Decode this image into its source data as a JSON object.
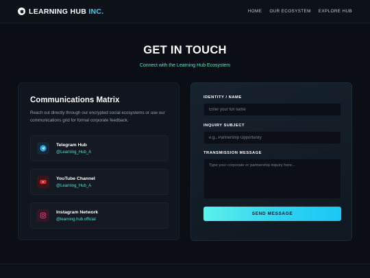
{
  "nav": {
    "brand_main": "LEARNING HUB ",
    "brand_accent": "INC.",
    "links": [
      "HOME",
      "OUR ECOSYSTEM",
      "EXPLORE HUB"
    ]
  },
  "hero": {
    "title": "GET IN TOUCH",
    "subtitle": "Connect with the Learning Hub Ecosystem"
  },
  "matrix": {
    "title": "Communications Matrix",
    "description": "Reach out directly through our encrypted social ecosystems or use our communications grid for formal corporate feedback.",
    "channels": [
      {
        "name": "Telegram Hub",
        "handle": "@Learning_Hub_A",
        "icon": "telegram-icon",
        "color": "#2aa3e0"
      },
      {
        "name": "YouTube Channel",
        "handle": "@Learning_Hub_A",
        "icon": "youtube-icon",
        "color": "#e02a2a"
      },
      {
        "name": "Instagram Network",
        "handle": "@learning.hub.official",
        "icon": "instagram-icon",
        "color": "#e23b76"
      }
    ]
  },
  "form": {
    "identity_label": "IDENTITY / NAME",
    "identity_placeholder": "Enter your full name",
    "inquiry_label": "INQUIRY SUBJECT",
    "inquiry_placeholder": "e.g., Partnership Opportunity",
    "message_label": "TRANSMISSION MESSAGE",
    "message_placeholder": "Type your corporate or partnership inquiry here...",
    "submit_label": "SEND MESSAGE"
  },
  "colors": {
    "accent": "#34d3ee",
    "teal_text": "#4ee6d3",
    "background": "#0b0e14"
  }
}
